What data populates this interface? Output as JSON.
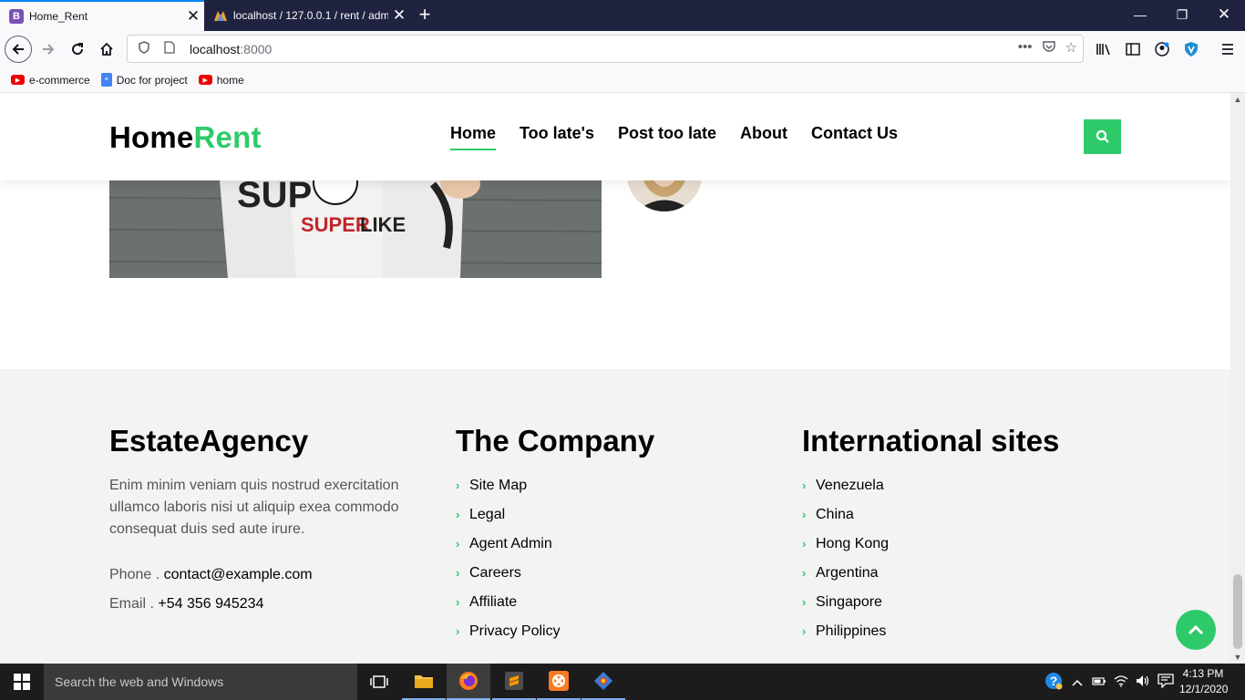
{
  "browser": {
    "tabs": [
      {
        "label": "Home_Rent",
        "favicon": "B",
        "active": true
      },
      {
        "label": "localhost / 127.0.0.1 / rent / adm",
        "active": false
      }
    ],
    "url": {
      "host": "localhost",
      "port": ":8000"
    },
    "bookmarks": [
      {
        "label": "e-commerce",
        "icon": "youtube-icon"
      },
      {
        "label": "Doc for project",
        "icon": "docs-icon"
      },
      {
        "label": "home",
        "icon": "youtube-icon"
      }
    ]
  },
  "site": {
    "brand_main": "Home",
    "brand_accent": "Rent",
    "nav": [
      {
        "label": "Home",
        "active": true
      },
      {
        "label": "Too late's",
        "active": false
      },
      {
        "label": "Post too late",
        "active": false
      },
      {
        "label": "About",
        "active": false
      },
      {
        "label": "Contact Us",
        "active": false
      }
    ],
    "accent_color": "#2eca6a"
  },
  "footer": {
    "agency": {
      "title": "EstateAgency",
      "description": "Enim minim veniam quis nostrud exercitation ullamco laboris nisi ut aliquip exea commodo consequat duis sed aute irure.",
      "phone_label": "Phone .",
      "phone_value": "contact@example.com",
      "email_label": "Email .",
      "email_value": "+54 356 945234"
    },
    "company": {
      "title": "The Company",
      "links": [
        "Site Map",
        "Legal",
        "Agent Admin",
        "Careers",
        "Affiliate",
        "Privacy Policy"
      ]
    },
    "international": {
      "title": "International sites",
      "links": [
        "Venezuela",
        "China",
        "Hong Kong",
        "Argentina",
        "Singapore",
        "Philippines"
      ]
    }
  },
  "taskbar": {
    "search_placeholder": "Search the web and Windows",
    "time": "4:13 PM",
    "date": "12/1/2020"
  }
}
